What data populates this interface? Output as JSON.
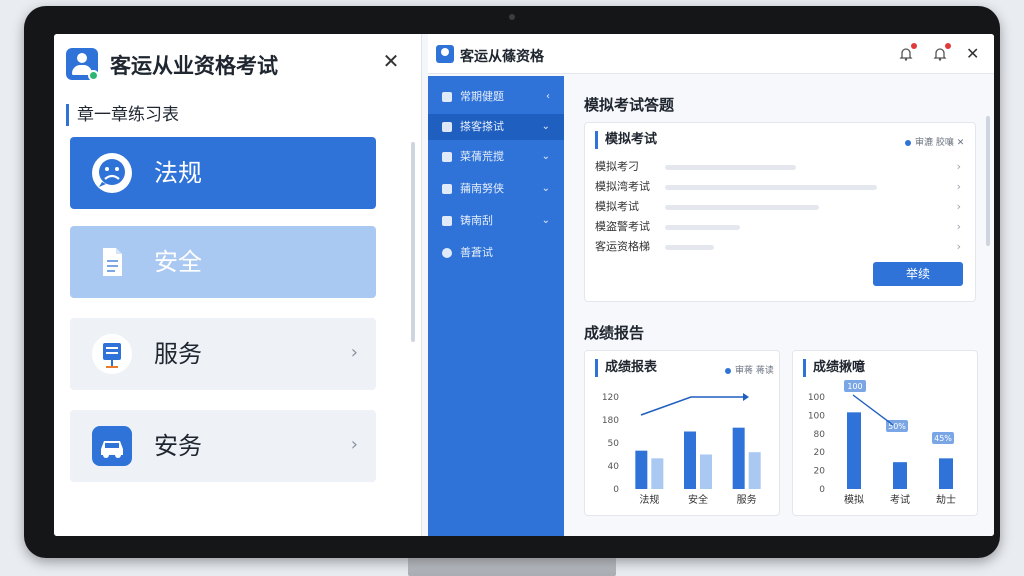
{
  "left_window": {
    "title": "客运从业资格考试",
    "close": "✕",
    "section_label": "章一章练习表",
    "categories": [
      {
        "label": "法规",
        "icon": "sad-face-icon"
      },
      {
        "label": "安全",
        "icon": "document-icon"
      },
      {
        "label": "服务",
        "icon": "service-sign-icon",
        "chevron": "›"
      },
      {
        "label": "安务",
        "icon": "car-icon",
        "chevron": "›"
      }
    ]
  },
  "right_window": {
    "title": "客运从蓧资格",
    "close": "✕",
    "toolbar_icons": [
      "bell-icon",
      "bell-icon"
    ],
    "sidebar": [
      {
        "label": "常期健题",
        "chevron": "‹"
      },
      {
        "label": "搽客搽试",
        "chevron": "⌄"
      },
      {
        "label": "菜蒨荒搅",
        "chevron": "⌄"
      },
      {
        "label": "蒱南努侠",
        "chevron": "⌄"
      },
      {
        "label": "铸南刮",
        "chevron": "⌄"
      },
      {
        "label": "善蒼试"
      }
    ],
    "exam_section_title": "模拟考试答题",
    "exam_card": {
      "title": "模拟考试",
      "legend": "审漉 胶嚷 ✕",
      "rows": [
        {
          "label": "模拟考刁",
          "bar": 0.45,
          "chevron": "›"
        },
        {
          "label": "模拟湾考试",
          "bar": 0.73,
          "chevron": "›"
        },
        {
          "label": "模拟考试",
          "bar": 0.53,
          "chevron": "›"
        },
        {
          "label": "模盗警考试",
          "bar": 0.26,
          "chevron": "›"
        },
        {
          "label": "客运资格梯",
          "bar": 0.17,
          "chevron": "›"
        }
      ],
      "button": "举续"
    },
    "report_section_title": "成绩报告",
    "chart_data": [
      {
        "type": "bar",
        "title": "成绩报表",
        "legend": "审蒋 蒋读",
        "categories": [
          "法规",
          "安全",
          "服务"
        ],
        "series": [
          {
            "values": [
              50,
              75,
              80
            ],
            "color": "#2f73d8"
          },
          {
            "values": [
              40,
              45,
              48
            ],
            "color": "#a9c8f2"
          }
        ],
        "y_ticks": [
          "120",
          "180",
          "50",
          "40",
          "0"
        ],
        "ylim": [
          0,
          120
        ],
        "trend_line": true
      },
      {
        "type": "bar",
        "title": "成绩揪噫",
        "categories": [
          "模拟",
          "考试",
          "劫士"
        ],
        "series": [
          {
            "values": [
              100,
              35,
              40
            ],
            "color": "#2f73d8",
            "value_labels": [
              "100",
              "",
              ""
            ]
          }
        ],
        "secondary": [
          {
            "values": [
              0,
              0,
              0
            ],
            "color": "#a9c8f2"
          }
        ],
        "annotations": [
          "100",
          "50%",
          "45%"
        ],
        "y_ticks": [
          "100",
          "100",
          "80",
          "20",
          "20",
          "0"
        ],
        "ylim": [
          0,
          120
        ]
      }
    ]
  }
}
